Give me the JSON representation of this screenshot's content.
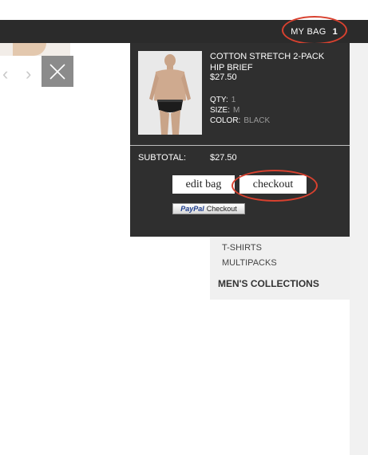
{
  "header": {
    "bag_label": "MY BAG",
    "bag_count": "1"
  },
  "cart": {
    "item": {
      "name_line1": "COTTON STRETCH 2-PACK",
      "name_line2": "HIP BRIEF",
      "price": "$27.50",
      "qty_label": "QTY:",
      "qty_value": "1",
      "size_label": "SIZE:",
      "size_value": "M",
      "color_label": "COLOR:",
      "color_value": "BLACK"
    },
    "subtotal_label": "SUBTOTAL:",
    "subtotal_value": "$27.50",
    "edit_bag_label": "edit bag",
    "checkout_label": "checkout",
    "paypal_logo": "PayPal",
    "paypal_label": "Checkout"
  },
  "menu": {
    "items": [
      "T-SHIRTS",
      "MULTIPACKS"
    ],
    "heading": "MEN'S COLLECTIONS"
  },
  "gallery": {
    "prev_icon": "chevron-left-icon",
    "next_icon": "chevron-right-icon",
    "close_icon": "close-icon"
  },
  "colors": {
    "topbar": "#2b2b2b",
    "dropdown": "#2f2f2f",
    "highlight": "#d8412f",
    "close_button": "#8b8b8b"
  }
}
